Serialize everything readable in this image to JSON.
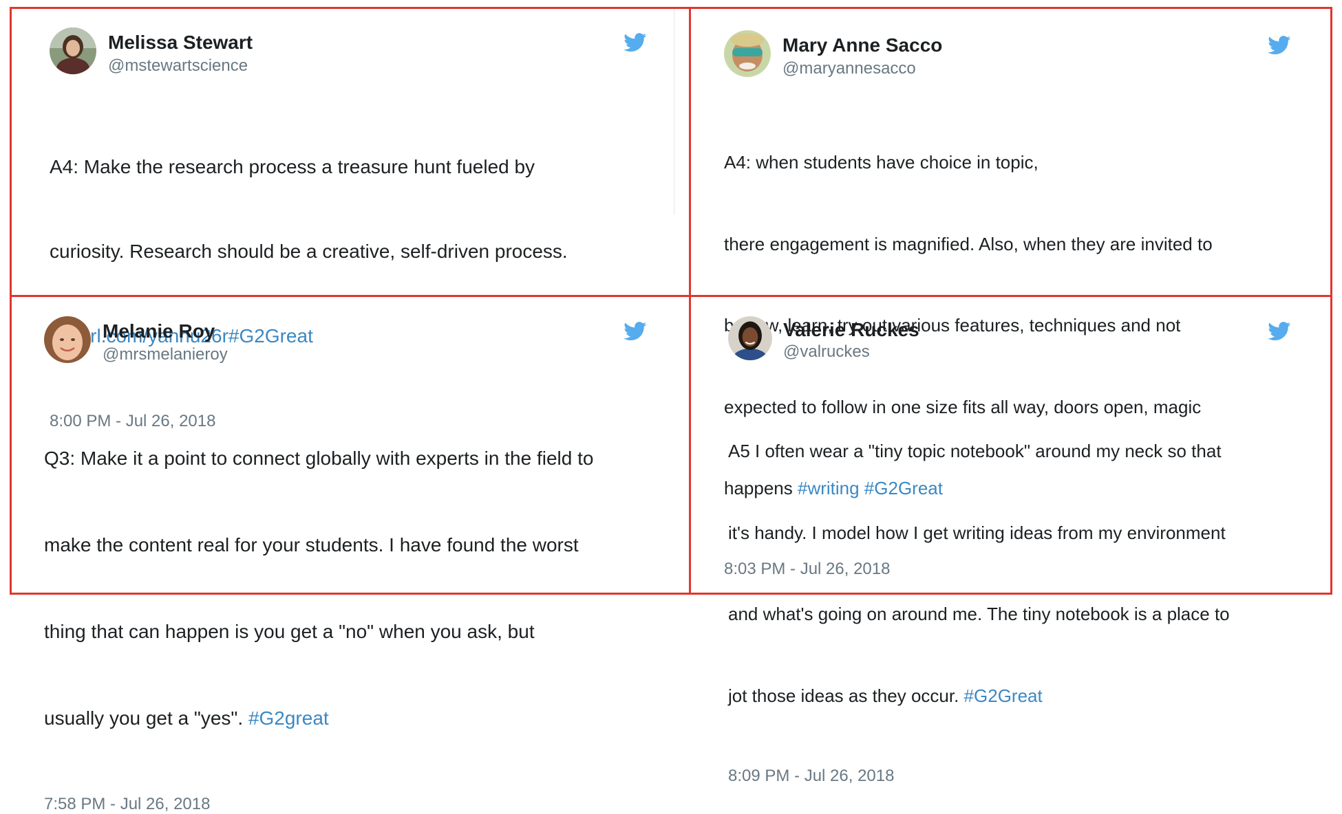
{
  "accent_link_color": "#3b88c3",
  "frame_color": "#e0362c",
  "twitter_blue": "#55acee",
  "tweets": [
    {
      "name": "Melissa Stewart",
      "handle": "@mstewartscience",
      "lines": [
        {
          "text": "A4: Make the research process a treasure hunt fueled by",
          "link": ""
        },
        {
          "text": "curiosity. Research should be a creative, self-driven process.",
          "link": ""
        },
        {
          "text": "",
          "link": "tinyurl.com/yahnu26r#G2Great"
        }
      ],
      "timestamp": "8:00 PM - Jul 26, 2018",
      "icon": "twitter-bird-icon"
    },
    {
      "name": "Mary Anne Sacco",
      "handle": "@maryannesacco",
      "lines": [
        {
          "text": "A4: when students have choice in topic,",
          "link": ""
        },
        {
          "text": "there engagement is magnified. Also, when they are invited to",
          "link": ""
        },
        {
          "text": "borrow, learn, try out various features, techniques and not",
          "link": ""
        },
        {
          "text": "expected to follow in one size fits all way, doors open, magic",
          "link": ""
        },
        {
          "text": "happens ",
          "link": "#writing #G2Great"
        }
      ],
      "timestamp": "8:03 PM - Jul 26, 2018",
      "icon": "twitter-bird-icon"
    },
    {
      "name": "Melanie Roy",
      "handle": "@mrsmelanieroy",
      "lines": [
        {
          "text": "Q3: Make it a point to connect globally with experts in the field to",
          "link": ""
        },
        {
          "text": "make the content real for your students. I have found the worst",
          "link": ""
        },
        {
          "text": "thing that can happen is you get a \"no\" when you ask, but",
          "link": ""
        },
        {
          "text": "usually you get a \"yes\".  ",
          "link": "#G2great"
        }
      ],
      "timestamp": "7:58 PM - Jul 26, 2018",
      "icon": "twitter-bird-icon"
    },
    {
      "name": "Valerie Ruckes",
      "handle": "@valruckes",
      "lines": [
        {
          "text": "A5 I often wear a \"tiny topic notebook\" around my neck so that",
          "link": ""
        },
        {
          "text": "it's handy.  I model how I get writing ideas from my environment",
          "link": ""
        },
        {
          "text": "and what's going on around me.  The tiny notebook is a place to",
          "link": ""
        },
        {
          "text": "jot those ideas as they occur. ",
          "link": "#G2Great"
        }
      ],
      "timestamp": "8:09 PM - Jul 26, 2018",
      "icon": "twitter-bird-icon"
    }
  ]
}
